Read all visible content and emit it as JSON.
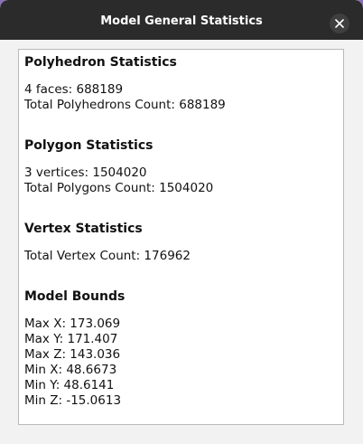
{
  "window": {
    "title": "Model General Statistics"
  },
  "polyhedron": {
    "heading": "Polyhedron Statistics",
    "lines": [
      "4 faces: 688189",
      "Total Polyhedrons Count: 688189"
    ]
  },
  "polygon": {
    "heading": "Polygon Statistics",
    "lines": [
      "3 vertices: 1504020",
      "Total Polygons Count: 1504020"
    ]
  },
  "vertex": {
    "heading": "Vertex Statistics",
    "lines": [
      "Total Vertex Count: 176962"
    ]
  },
  "bounds": {
    "heading": "Model Bounds",
    "lines": [
      "Max X: 173.069",
      "Max Y: 171.407",
      "Max Z: 143.036",
      "Min X: 48.6673",
      "Min Y: 48.6141",
      "Min Z: -15.0613"
    ]
  },
  "colors": {
    "titlebar": "#2b2b2b",
    "window_bg": "#f2f2f2",
    "panel_bg": "#ffffff",
    "desktop": "#8a6fb8"
  },
  "icons": {
    "close": "close-icon"
  }
}
